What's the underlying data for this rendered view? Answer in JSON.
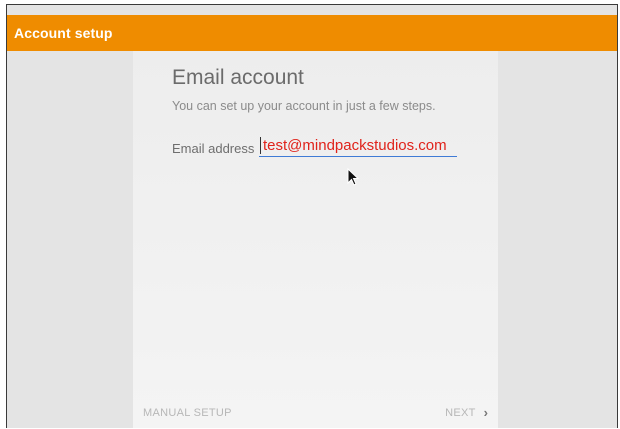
{
  "app_bar": {
    "title": "Account setup",
    "color": "#ef8c00"
  },
  "form": {
    "heading": "Email account",
    "subheading": "You can set up your account in just a few steps.",
    "email_label": "Email address",
    "email_value": "test@mindpackstudios.com"
  },
  "footer": {
    "manual_setup_label": "MANUAL SETUP",
    "next_label": "NEXT",
    "next_icon": "chevron-right-icon"
  }
}
